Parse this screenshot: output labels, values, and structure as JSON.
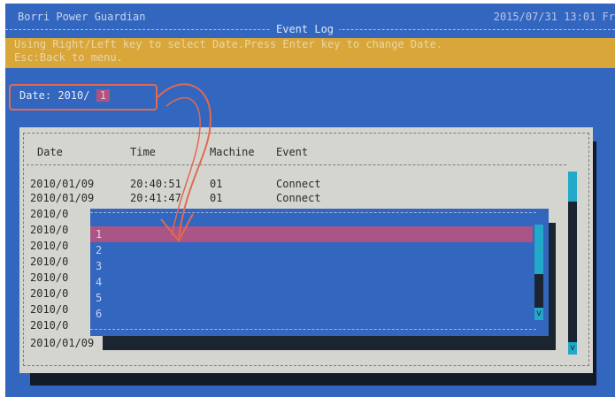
{
  "app": {
    "title": "Borri Power Guardian",
    "datetime": "2015/07/31 13:01 Fr"
  },
  "screen_title": "Event Log",
  "instructions": {
    "line1": "Using Right/Left key to select Date.Press Enter key to change Date.",
    "line2": "Esc:Back to menu."
  },
  "date_field": {
    "label": "Date:",
    "year": "2010/",
    "month_cursor": "1"
  },
  "log": {
    "columns": [
      "Date",
      "Time",
      "Machine",
      "Event"
    ],
    "rows": [
      {
        "date": "2010/01/09",
        "time": "20:40:51",
        "machine": "01",
        "event": "Connect"
      },
      {
        "date": "2010/01/09",
        "time": "20:41:47",
        "machine": "01",
        "event": "Connect"
      },
      {
        "date": "2010/0"
      },
      {
        "date": "2010/0"
      },
      {
        "date": "2010/0"
      },
      {
        "date": "2010/0"
      },
      {
        "date": "2010/0"
      },
      {
        "date": "2010/0"
      },
      {
        "date": "2010/0"
      },
      {
        "date": "2010/0"
      },
      {
        "date": "2010/01/09"
      }
    ]
  },
  "month_dropdown": {
    "options": [
      "1",
      "2",
      "3",
      "4",
      "5",
      "6"
    ],
    "selected_index": 0
  },
  "scroll_arrow_glyph": "v",
  "colors": {
    "screen_bg": "#3366bf",
    "instruction_bar": "#d9a63a",
    "selection": "#a95586",
    "scroll_thumb": "#22a8c8",
    "annotation": "#e06a50"
  }
}
